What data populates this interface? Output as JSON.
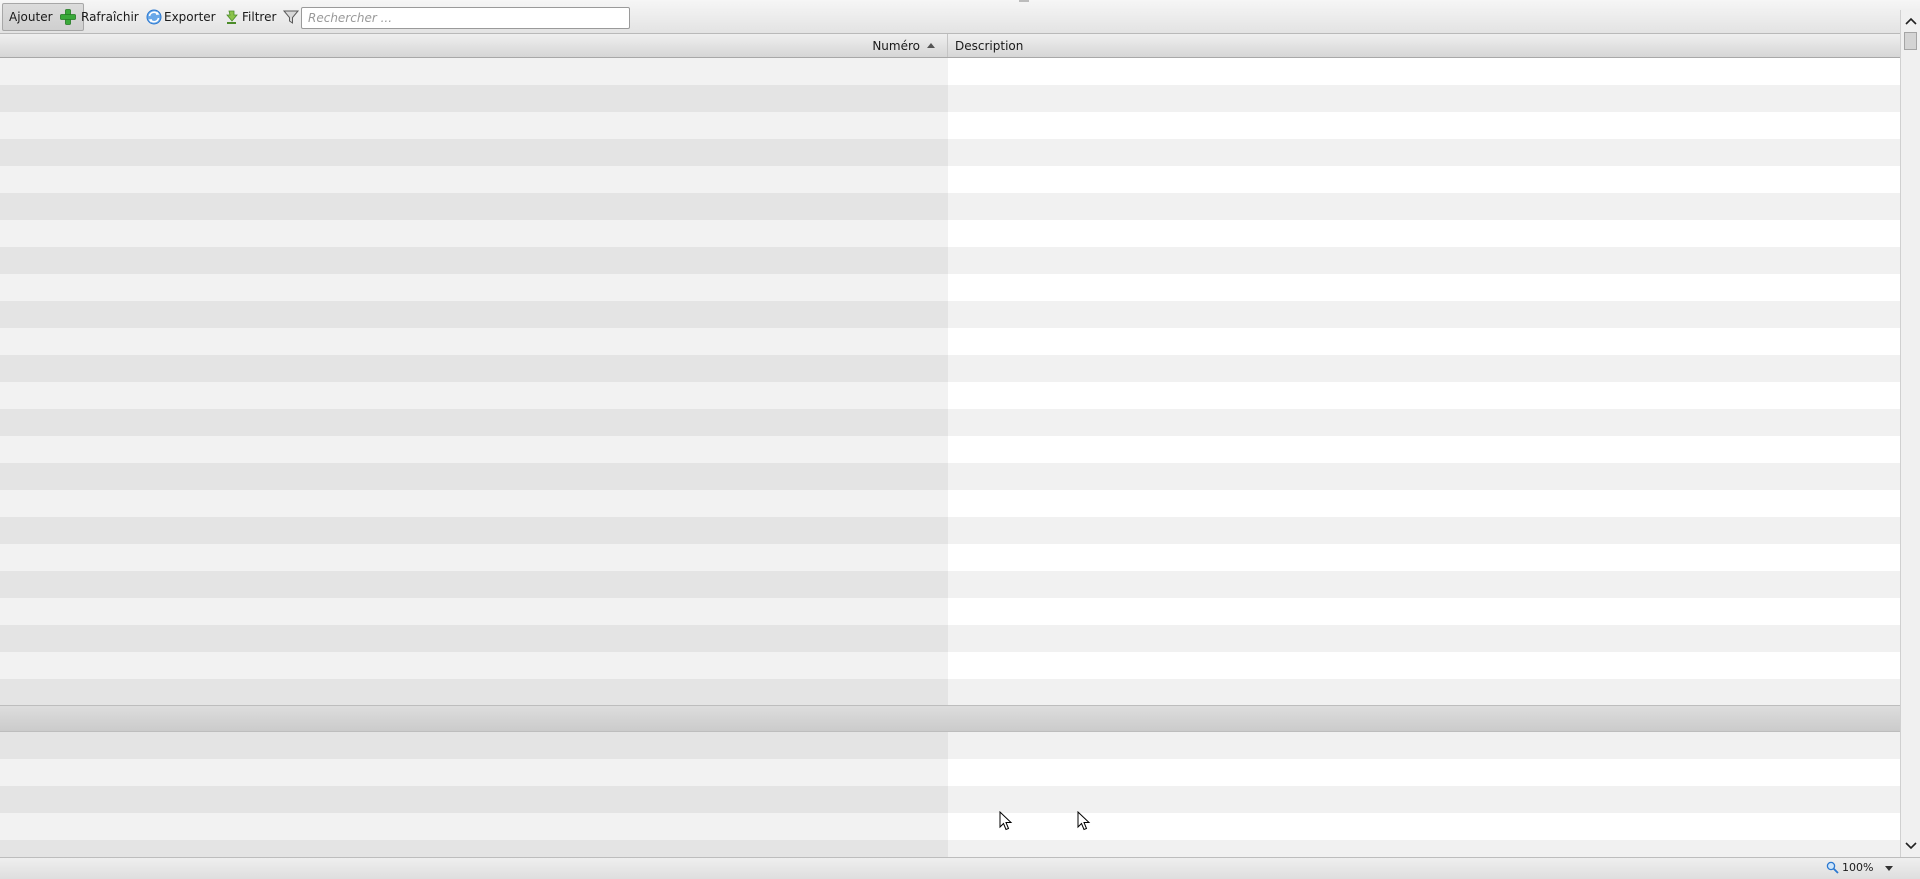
{
  "toolbar": {
    "add_label": "Ajouter",
    "refresh_label": "Rafraîchir",
    "export_label": "Exporter",
    "filter_label": "Filtrer",
    "search_placeholder": "Rechercher ...",
    "search_value": ""
  },
  "grid": {
    "columns": [
      {
        "label": "Numéro",
        "sort": "ascending"
      },
      {
        "label": "Description"
      }
    ],
    "rows": []
  },
  "statusbar": {
    "zoom": "100%"
  },
  "icons": {
    "add": "add-icon",
    "refresh": "refresh-icon",
    "export": "export-icon",
    "filter": "filter-icon",
    "zoom": "magnifier-icon"
  },
  "colors": {
    "add_icon": "#3aa93a",
    "refresh_icon": "#2b78d0",
    "export_icon": "#4caf50"
  }
}
